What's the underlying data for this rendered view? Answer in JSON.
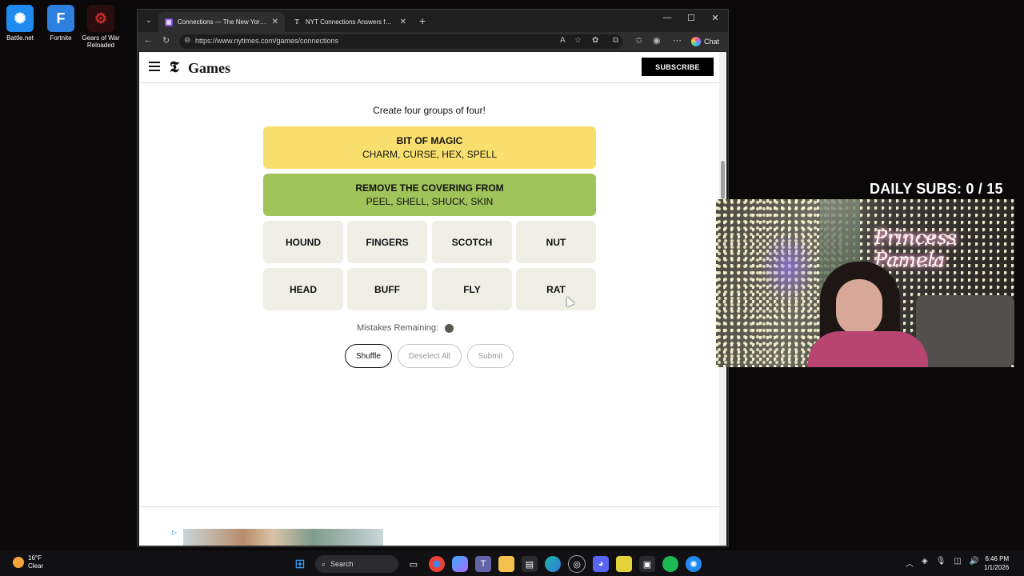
{
  "desktop": {
    "icons": [
      {
        "label": "Battle.net",
        "icon": "battlenet-icon",
        "color": "#1f8bf0"
      },
      {
        "label": "Fortnite",
        "icon": "fortnite-icon",
        "color": "#2d7fe0"
      },
      {
        "label": "Gears of War Reloaded",
        "icon": "gears-of-war-icon",
        "color": "#7b1b1b"
      }
    ]
  },
  "browser": {
    "tabs": [
      {
        "title": "Connections — The New York Tim",
        "icon": "nyt-games-favicon"
      },
      {
        "title": "NYT Connections Answers for Jan",
        "icon": "nyt-favicon"
      }
    ],
    "url": "https://www.nytimes.com/games/connections",
    "chat_label": "Chat"
  },
  "nyt": {
    "logo_t": "𝕿",
    "games": "Games",
    "subscribe": "SUBSCRIBE",
    "subtitle": "Create four groups of four!",
    "solved_groups": [
      {
        "category": "BIT OF MAGIC",
        "words": "CHARM, CURSE, HEX, SPELL",
        "color": "#f9df6d"
      },
      {
        "category": "REMOVE THE COVERING FROM",
        "words": "PEEL, SHELL, SHUCK, SKIN",
        "color": "#a0c35a"
      }
    ],
    "tiles": [
      "HOUND",
      "FINGERS",
      "SCOTCH",
      "NUT",
      "HEAD",
      "BUFF",
      "FLY",
      "RAT"
    ],
    "mistakes_label": "Mistakes Remaining:",
    "mistakes_remaining": 1,
    "buttons": {
      "shuffle": "Shuffle",
      "deselect": "Deselect All",
      "submit": "Submit"
    }
  },
  "overlay": {
    "daily_subs": "DAILY SUBS:  0 / 15",
    "neon_sign": "Princess Pamela"
  },
  "taskbar": {
    "weather_temp": "16°F",
    "weather_desc": "Clear",
    "search": "Search",
    "time": "6:46 PM",
    "date": "1/1/2026"
  }
}
